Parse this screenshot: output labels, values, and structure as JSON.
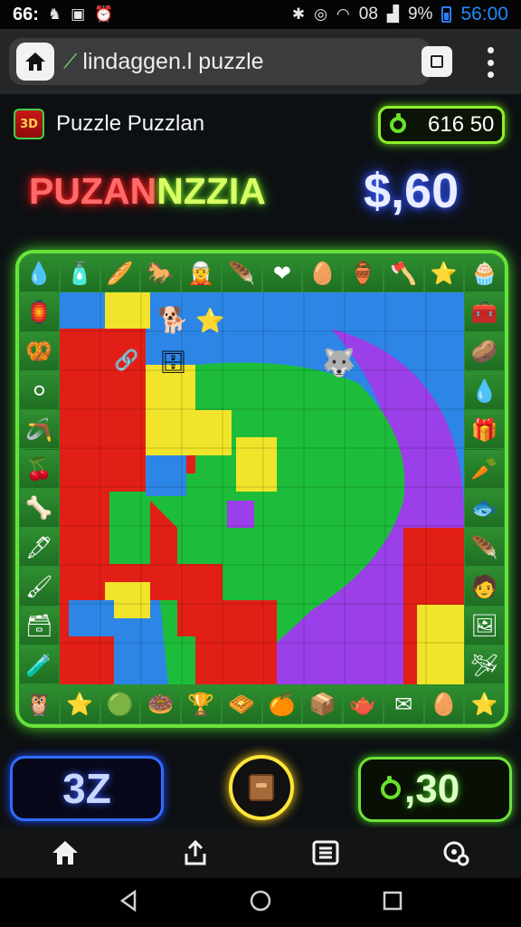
{
  "status_bar": {
    "time": "66:",
    "clock": "56:00",
    "signal_label": "08",
    "battery": "9%",
    "icons": [
      "notification-icon",
      "screenshot-icon",
      "alarm-icon",
      "bluetooth-icon",
      "target-icon",
      "wifi-icon",
      "signal-icon",
      "battery-icon"
    ]
  },
  "browser": {
    "url": "lindaggen.l puzzle",
    "icons": [
      "home-icon",
      "link-icon",
      "tabs-icon",
      "more-options-icon"
    ]
  },
  "header": {
    "app_icon_text": "3D",
    "title": "Puzzle Puzzlan",
    "coins": "616 50",
    "neon_title_part1": "PUZAN",
    "neon_title_part2": "NZZIA",
    "score": "$,60"
  },
  "board": {
    "border_icons": [
      "💧",
      "🧴",
      "🥖",
      "🐎",
      "🧝",
      "🪶",
      "❤",
      "🥚",
      "🏺",
      "🪓",
      "⭐",
      "🧁",
      "🏮",
      "🧰",
      "🥨",
      "🥔",
      "⚪",
      "💧",
      "🪃",
      "🎁",
      "🍒",
      "🥕",
      "🦴",
      "🐟",
      "🖋",
      "🪶",
      "🖌",
      "🧑",
      "🗃",
      "🖼",
      "🧪",
      "🛩",
      "🦉",
      "⭐",
      "🟢",
      "🍩",
      "🏆",
      "🧇",
      "🍊",
      "📦",
      "🫖",
      "✉",
      "🥚",
      "⭐",
      "🍌",
      "❤",
      "🖼"
    ],
    "puzzle_items": [
      "🐕",
      "⭐",
      "🐺",
      "🔗",
      "🗄"
    ],
    "piece_colors": [
      "#e21f17",
      "#f2e42a",
      "#2d86e6",
      "#1dbd3b",
      "#9b3fe8"
    ]
  },
  "actions": {
    "moves": "3Z",
    "bonus": ",30"
  },
  "bottom_nav": [
    "home-icon",
    "share-icon",
    "list-icon",
    "settings-icon"
  ],
  "system_nav": [
    "back-icon",
    "home-circle-icon",
    "recents-icon"
  ]
}
